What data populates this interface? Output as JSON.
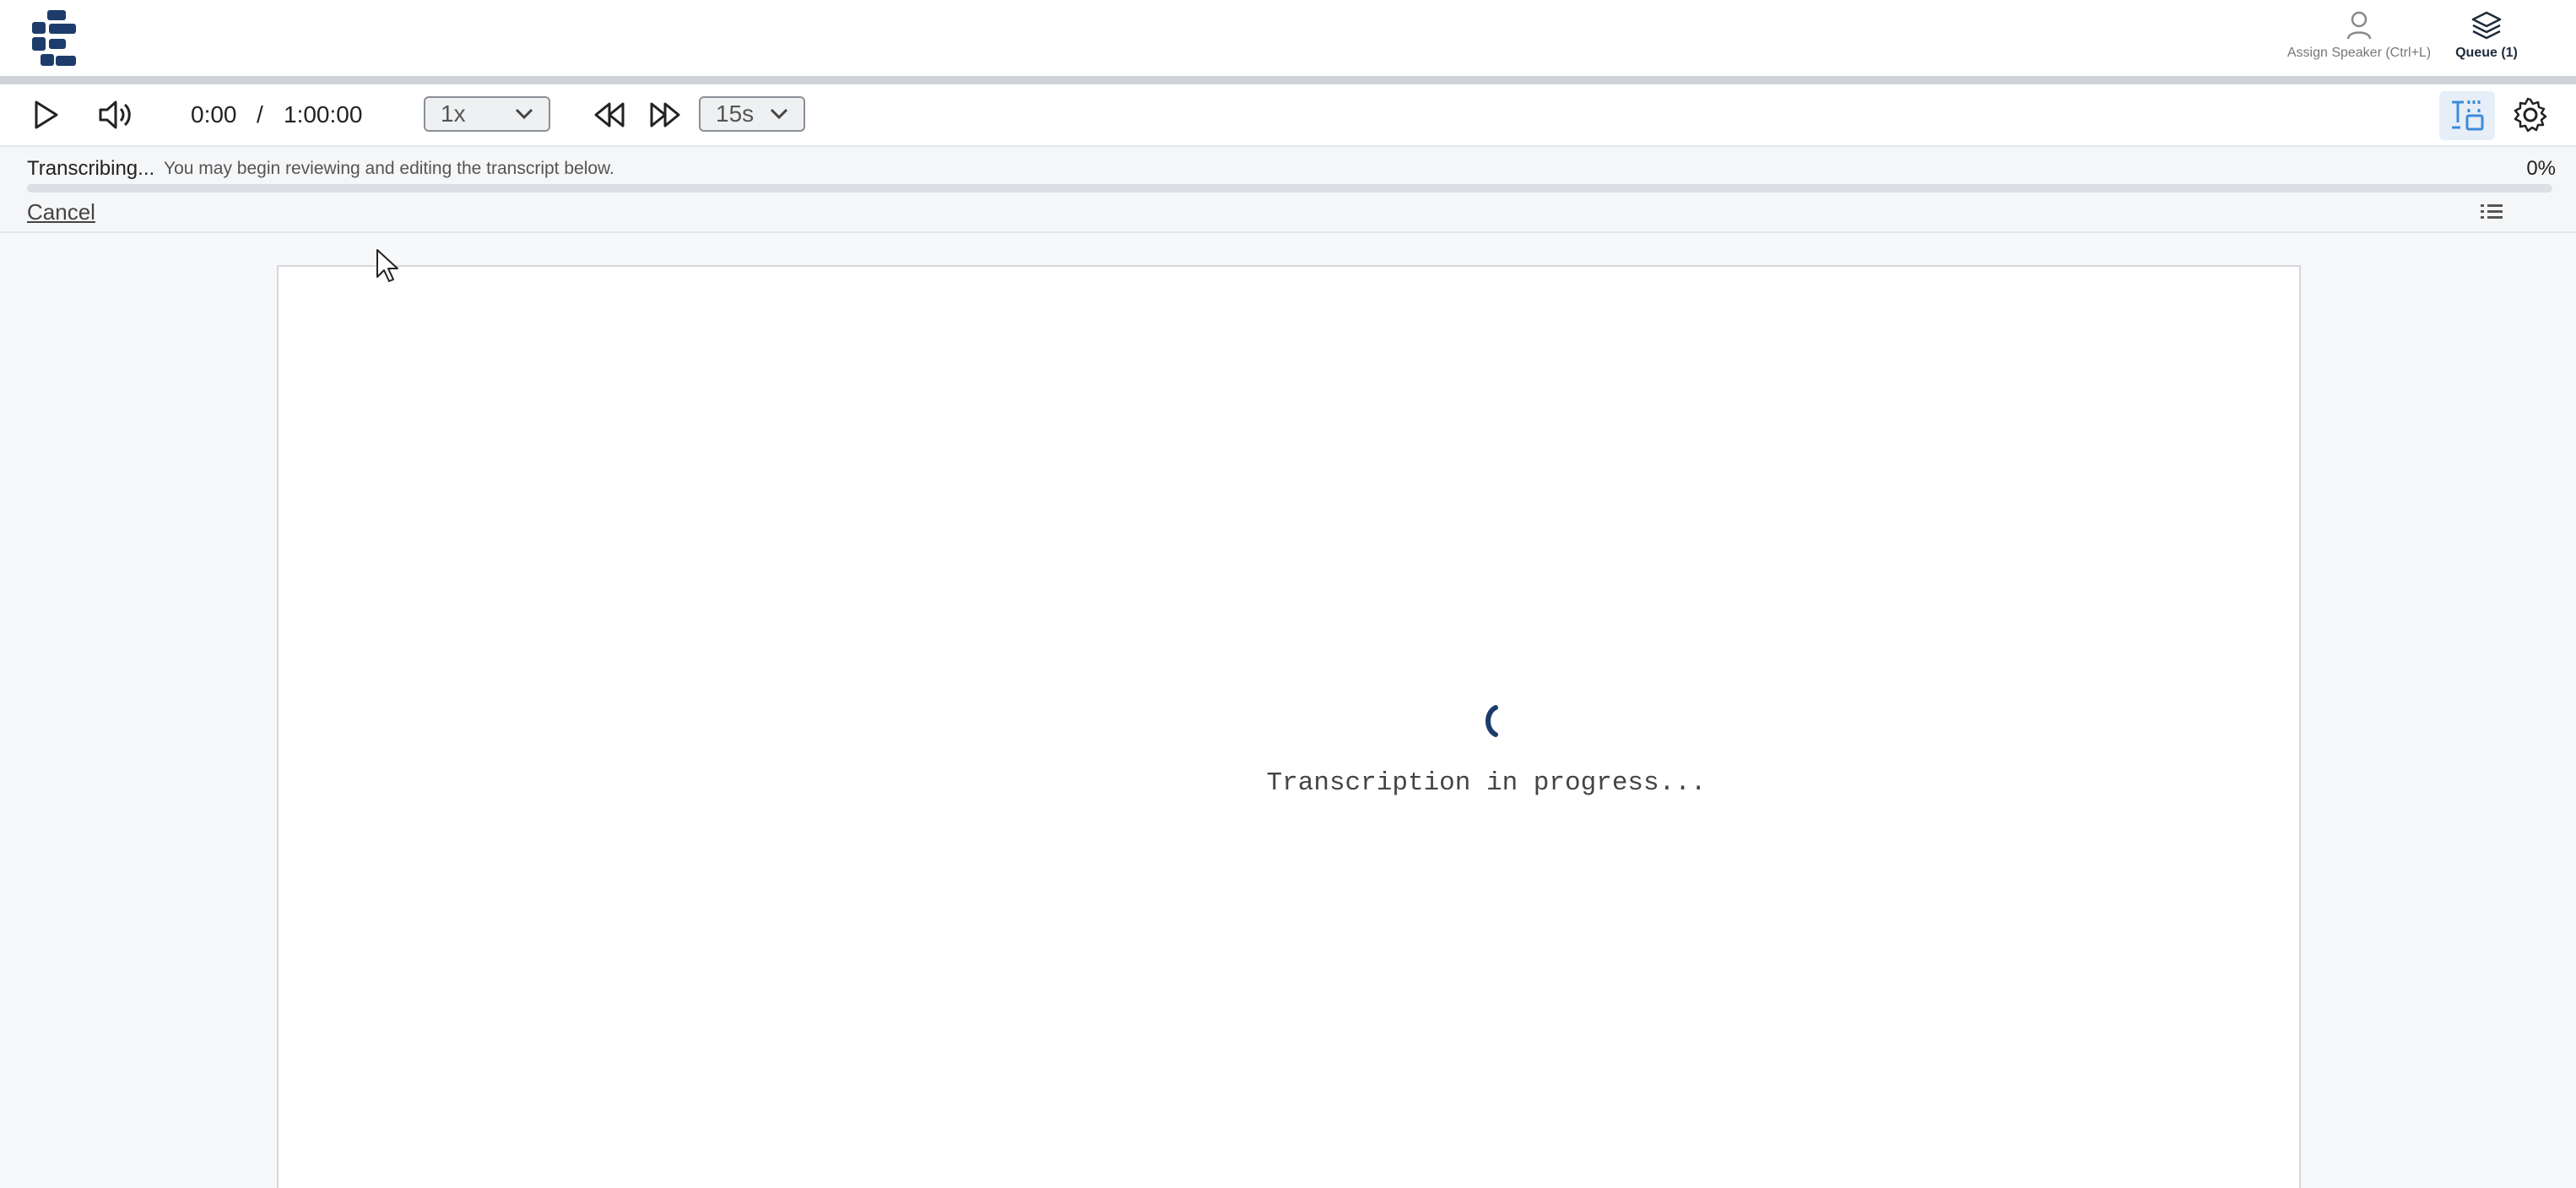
{
  "header": {
    "assign_speaker_label": "Assign Speaker (Ctrl+L)",
    "queue_label": "Queue (1)"
  },
  "player": {
    "current_time": "0:00",
    "separator": "/",
    "duration": "1:00:00",
    "speed": "1x",
    "skip_interval": "15s"
  },
  "status": {
    "title": "Transcribing...",
    "hint": "You may begin reviewing and editing the transcript below.",
    "percent_label": "0%",
    "progress": 0,
    "cancel_label": "Cancel"
  },
  "document": {
    "progress_message": "Transcription in progress..."
  },
  "colors": {
    "brand": "#1d3c6b",
    "accent": "#3d8bd9"
  }
}
